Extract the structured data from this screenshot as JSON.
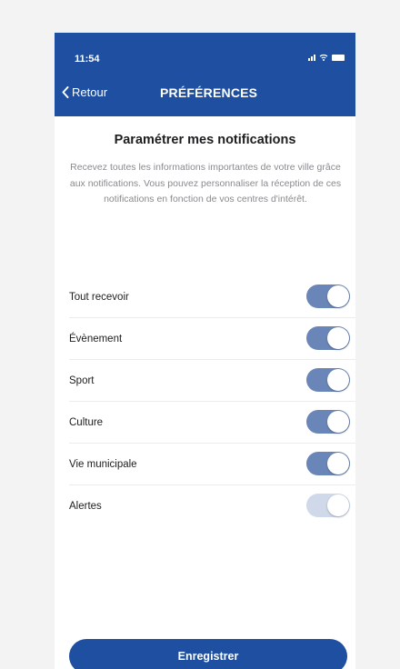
{
  "status_bar": {
    "time": "11:54",
    "icons": [
      "signal-icon",
      "wifi-icon",
      "battery-icon"
    ]
  },
  "header": {
    "back_label": "Retour",
    "title": "PRÉFÉRENCES",
    "background": "#1e4fa0"
  },
  "section": {
    "title": "Paramétrer mes notifications",
    "description": "Recevez toutes les informations importantes de votre ville grâce aux notifications. Vous pouvez personnaliser la réception de ces notifications en fonction de vos centres d'intérêt."
  },
  "preferences": [
    {
      "label": "Tout recevoir",
      "enabled": true,
      "disabled": false
    },
    {
      "label": "Évènement",
      "enabled": true,
      "disabled": false
    },
    {
      "label": "Sport",
      "enabled": true,
      "disabled": false
    },
    {
      "label": "Culture",
      "enabled": true,
      "disabled": false
    },
    {
      "label": "Vie municipale",
      "enabled": true,
      "disabled": false
    },
    {
      "label": "Alertes",
      "enabled": true,
      "disabled": true
    }
  ],
  "save_button": {
    "label": "Enregistrer",
    "color": "#1e4fa0"
  },
  "toggle_color": "#6a86b9"
}
